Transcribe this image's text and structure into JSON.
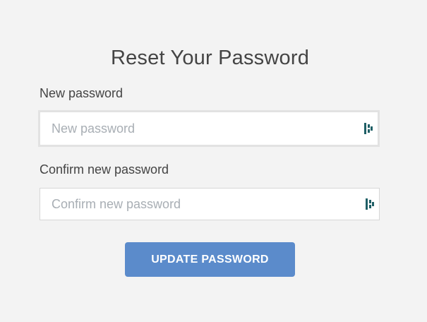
{
  "form": {
    "title": "Reset Your Password",
    "new_password": {
      "label": "New password",
      "placeholder": "New password",
      "value": ""
    },
    "confirm_password": {
      "label": "Confirm new password",
      "placeholder": "Confirm new password",
      "value": ""
    },
    "submit_label": "UPDATE PASSWORD"
  },
  "icons": {
    "password_manager": "password-manager-icon"
  },
  "colors": {
    "background": "#f3f3f3",
    "button": "#5b8bcb",
    "icon": "#1f5f66"
  }
}
